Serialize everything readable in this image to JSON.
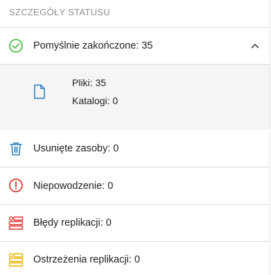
{
  "section": {
    "title": "SZCZEGÓŁY STATUSU"
  },
  "success": {
    "label": "Pomyślnie zakończone: 35",
    "color": "#3db53d",
    "expanded": true
  },
  "details": {
    "files": "Pliki: 35",
    "folders": "Katalogi: 0",
    "icon_color": "#2b7bbf"
  },
  "deleted": {
    "label": "Usunięte zasoby: 0",
    "color": "#2b7bbf"
  },
  "failure": {
    "label": "Niepowodzenie: 0",
    "color": "#e0302a"
  },
  "replication_errors": {
    "label": "Błędy replikacji: 0",
    "color": "#e0302a"
  },
  "replication_warnings": {
    "label": "Ostrzeżenia replikacji: 0",
    "color": "#e8b400"
  }
}
